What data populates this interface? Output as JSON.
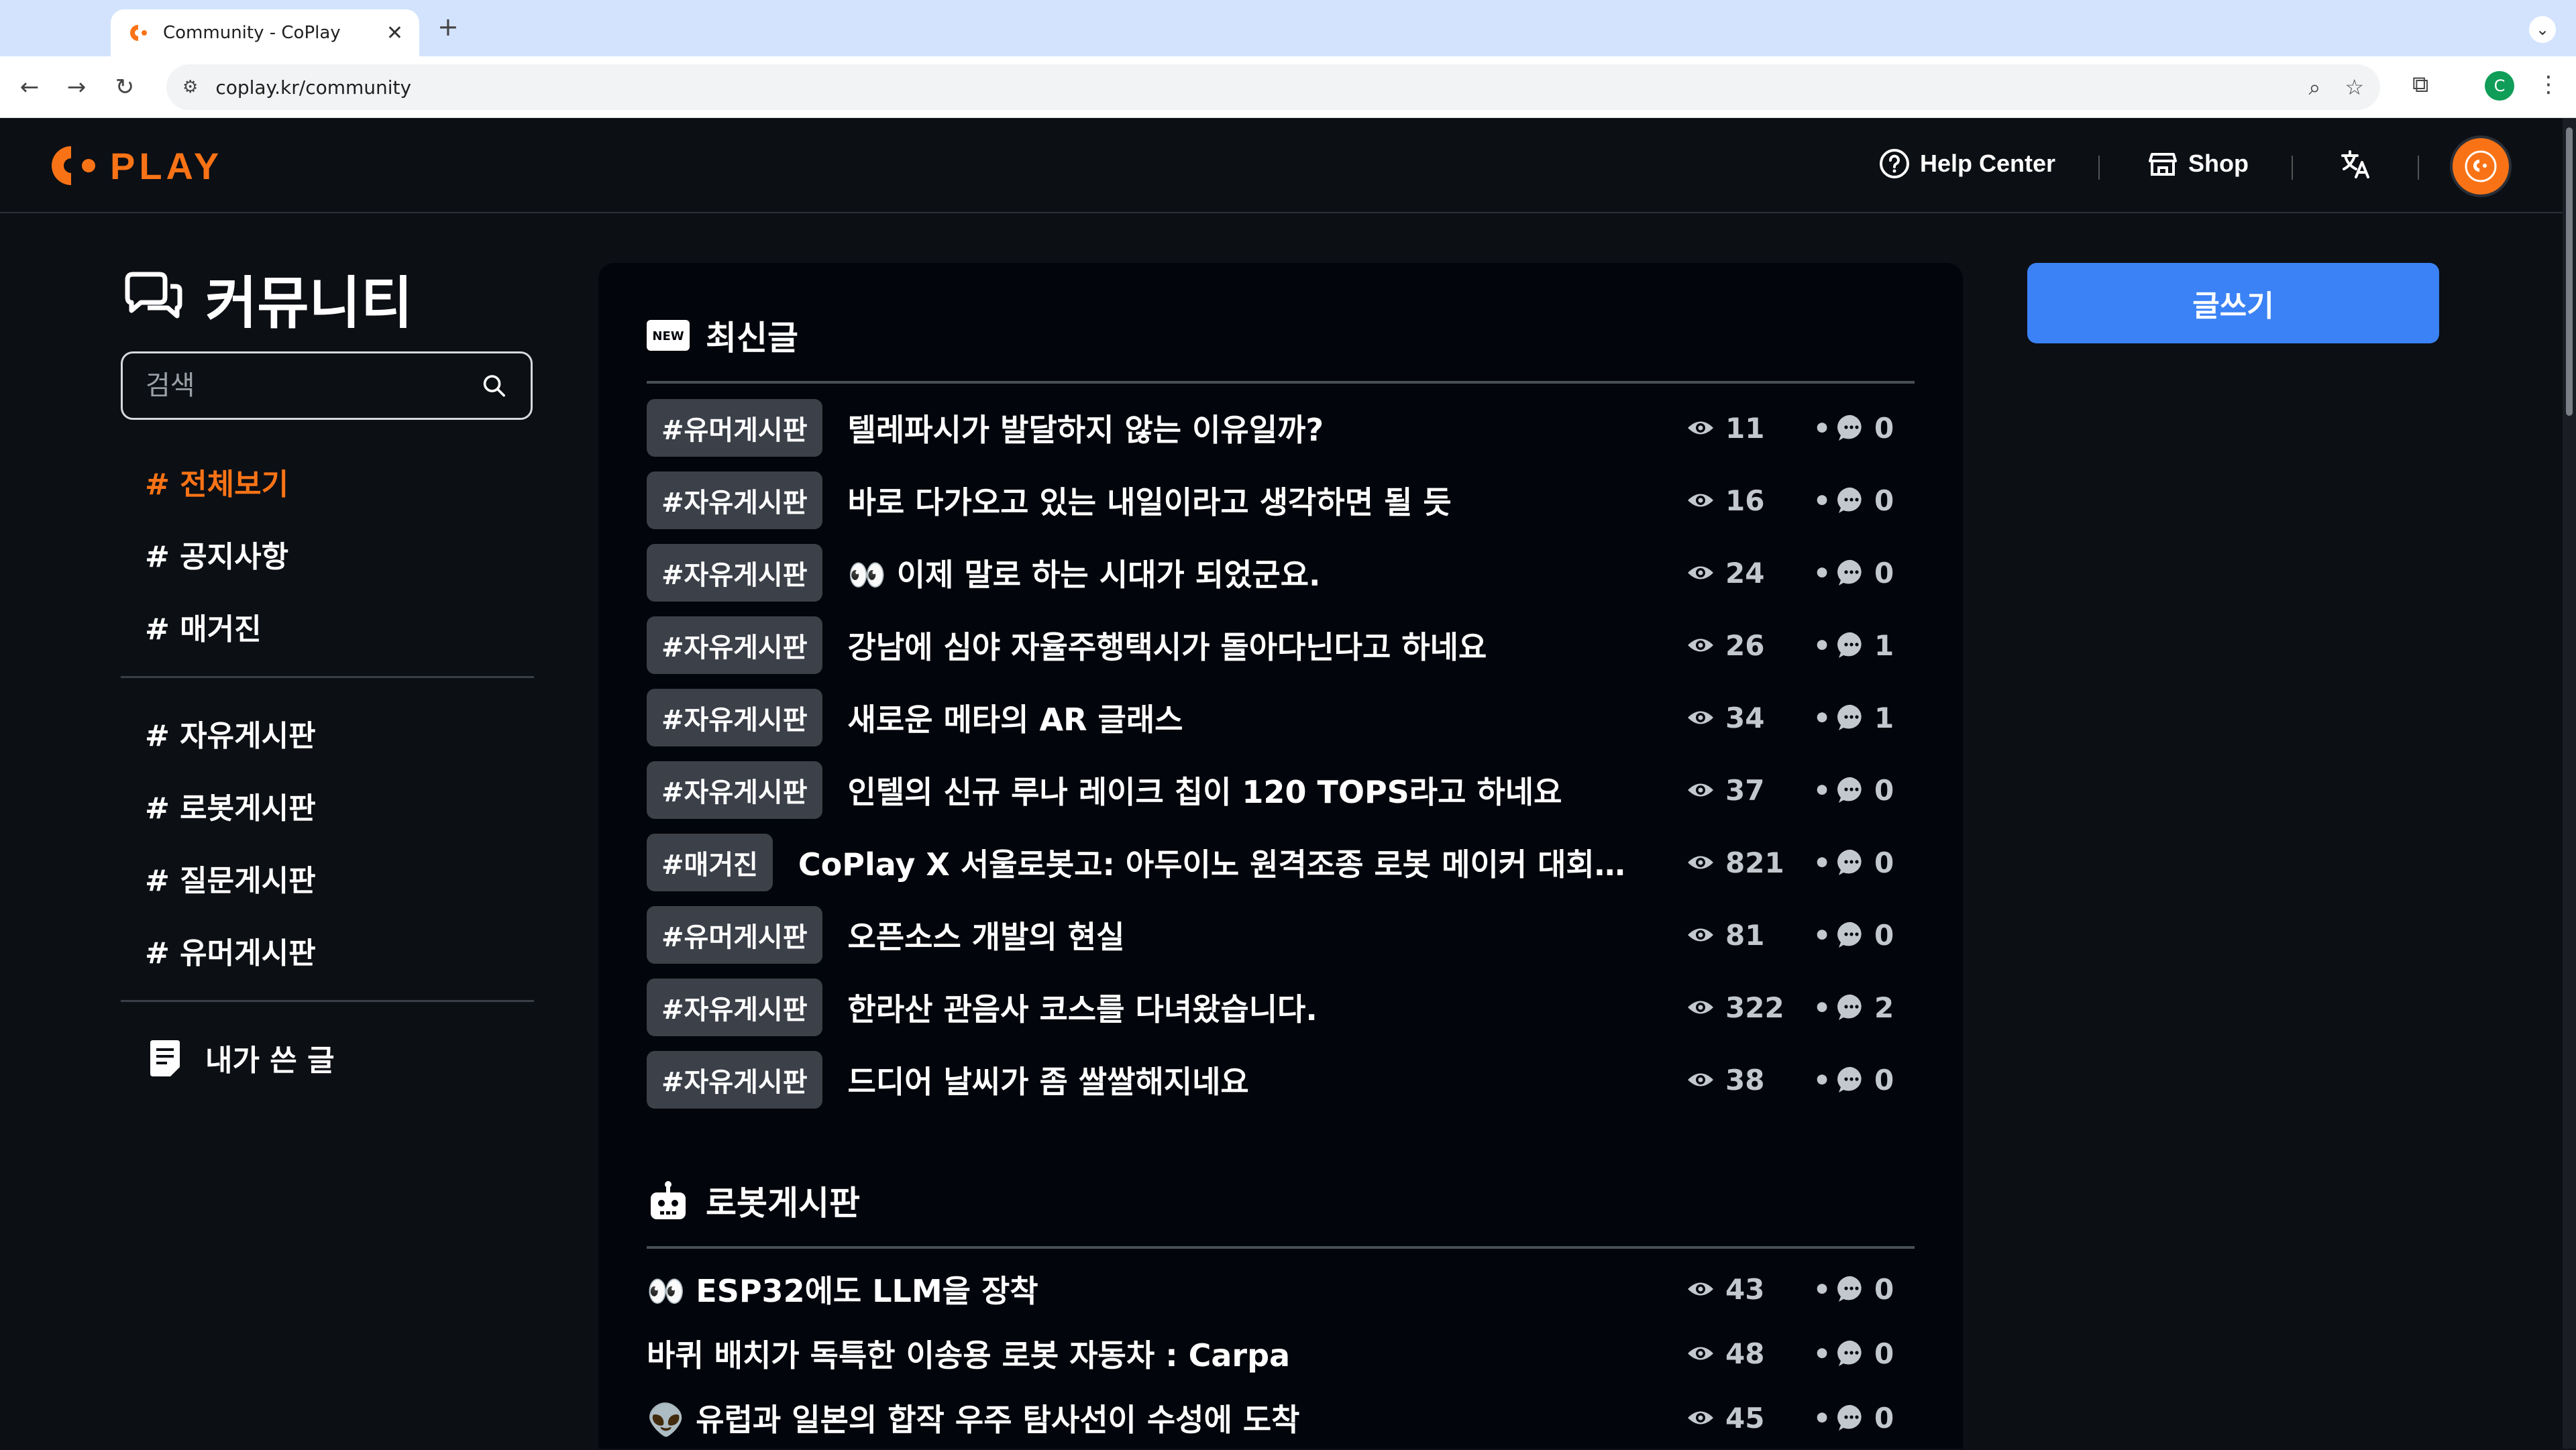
{
  "browser": {
    "tab_title": "Community - CoPlay",
    "tab_close": "✕",
    "new_tab": "+",
    "url": "coplay.kr/community",
    "profile_initial": "C"
  },
  "header": {
    "logo_text": "PLAY",
    "help_center": "Help Center",
    "shop": "Shop"
  },
  "sidebar": {
    "title": "커뮤니티",
    "search_placeholder": "검색",
    "items_top": [
      {
        "label": "# 전체보기",
        "active": true
      },
      {
        "label": "# 공지사항"
      },
      {
        "label": "# 매거진"
      }
    ],
    "items_boards": [
      {
        "label": "# 자유게시판"
      },
      {
        "label": "# 로봇게시판"
      },
      {
        "label": "# 질문게시판"
      },
      {
        "label": "# 유머게시판"
      }
    ],
    "my_posts": "내가 쓴 글"
  },
  "write_button": "글쓰기",
  "latest": {
    "badge": "NEW",
    "title": "최신글",
    "posts": [
      {
        "tag": "#유머게시판",
        "title": "텔레파시가 발달하지 않는 이유일까?",
        "views": "11",
        "comments": "0"
      },
      {
        "tag": "#자유게시판",
        "title": "바로 다가오고 있는 내일이라고 생각하면 될 듯",
        "views": "16",
        "comments": "0"
      },
      {
        "tag": "#자유게시판",
        "title": "👀 이제 말로 하는 시대가 되었군요.",
        "views": "24",
        "comments": "0"
      },
      {
        "tag": "#자유게시판",
        "title": "강남에 심야 자율주행택시가 돌아다닌다고 하네요",
        "views": "26",
        "comments": "1"
      },
      {
        "tag": "#자유게시판",
        "title": "새로운 메타의 AR 글래스",
        "views": "34",
        "comments": "1"
      },
      {
        "tag": "#자유게시판",
        "title": "인텔의 신규 루나 레이크 칩이 120 TOPS라고 하네요",
        "views": "37",
        "comments": "0"
      },
      {
        "tag": "#매거진",
        "title": "CoPlay X 서울로봇고: 아두이노 원격조종 로봇 메이커 대회 OT ...",
        "views": "821",
        "comments": "0"
      },
      {
        "tag": "#유머게시판",
        "title": "오픈소스 개발의 현실",
        "views": "81",
        "comments": "0"
      },
      {
        "tag": "#자유게시판",
        "title": "한라산 관음사 코스를 다녀왔습니다.",
        "views": "322",
        "comments": "2"
      },
      {
        "tag": "#자유게시판",
        "title": "드디어 날씨가 좀 쌀쌀해지네요",
        "views": "38",
        "comments": "0"
      }
    ]
  },
  "robot_board": {
    "title": "로봇게시판",
    "posts": [
      {
        "title": "👀 ESP32에도 LLM을 장착",
        "views": "43",
        "comments": "0"
      },
      {
        "title": "바퀴 배치가 독특한 이송용 로봇 자동차 : Carpa",
        "views": "48",
        "comments": "0"
      },
      {
        "title": "👽 유럽과 일본의 합작 우주 탐사선이 수성에 도착",
        "views": "45",
        "comments": "0"
      }
    ]
  },
  "separator_dot": "•",
  "colors": {
    "accent": "#f97316",
    "write_button": "#3b82f6",
    "tag_bg": "#3b4049",
    "page_bg": "#0c0f14"
  }
}
